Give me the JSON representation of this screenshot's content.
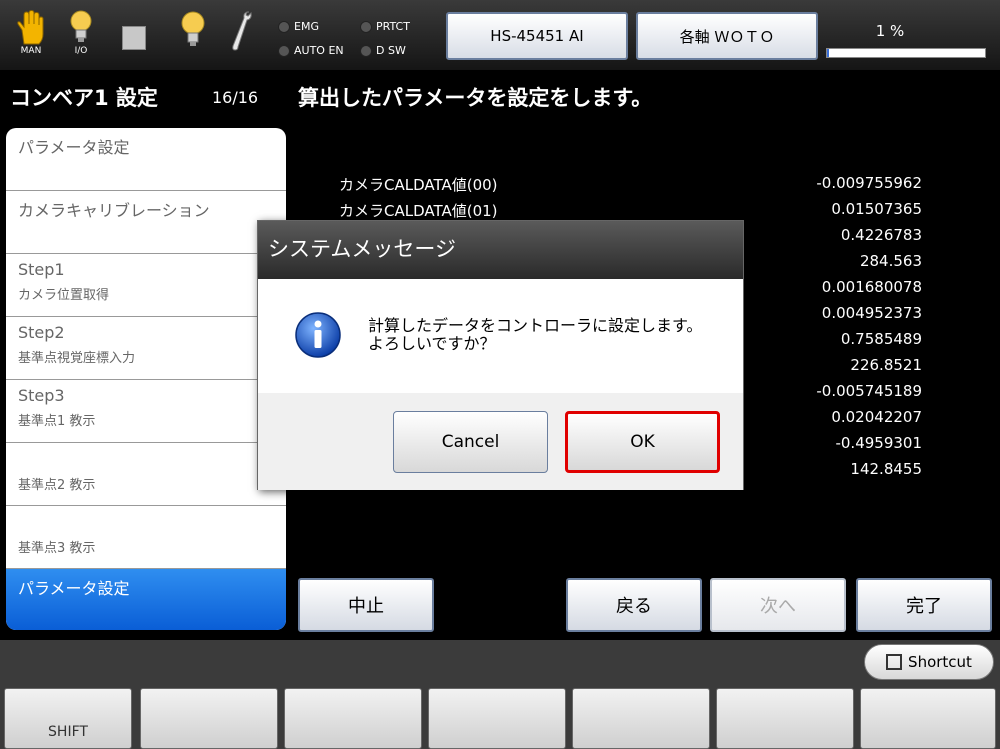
{
  "topbar": {
    "man_label": "MAN",
    "io_label": "I/O",
    "lamps": [
      {
        "label": "EMG"
      },
      {
        "label": "PRTCT"
      },
      {
        "label": "AUTO EN"
      },
      {
        "label": "D SW"
      }
    ],
    "robot_button": "HS-45451 AI",
    "axis_button": "各軸 ＷＯＴＯ",
    "speed_percent": "1 %",
    "speed_value": 0.01
  },
  "left_panel": {
    "title": "コンベア1 設定",
    "counter": "16/16",
    "items": [
      {
        "line1": "パラメータ設定",
        "line2": ""
      },
      {
        "line1": "カメラキャリブレーション",
        "line2": ""
      },
      {
        "line1": "Step1",
        "line2": "カメラ位置取得"
      },
      {
        "line1": "Step2",
        "line2": "基準点視覚座標入力"
      },
      {
        "line1": "Step3",
        "line2": "基準点1 教示"
      },
      {
        "line1": "",
        "line2": "基準点2 教示"
      },
      {
        "line1": "",
        "line2": "基準点3 教示"
      },
      {
        "line1": "パラメータ設定",
        "line2": ""
      }
    ]
  },
  "main": {
    "heading": "算出したパラメータを設定をします。",
    "rows": [
      {
        "name": "カメラCALDATA値(00)",
        "value": "-0.009755962"
      },
      {
        "name": "カメラCALDATA値(01)",
        "value": "0.01507365"
      },
      {
        "name": "",
        "value": "0.4226783"
      },
      {
        "name": "",
        "value": "284.563"
      },
      {
        "name": "",
        "value": "0.001680078"
      },
      {
        "name": "",
        "value": "0.004952373"
      },
      {
        "name": "",
        "value": "0.7585489"
      },
      {
        "name": "",
        "value": "226.8521"
      },
      {
        "name": "",
        "value": "-0.005745189"
      },
      {
        "name": "",
        "value": "0.02042207"
      },
      {
        "name": "",
        "value": "-0.4959301"
      },
      {
        "name": "",
        "value": "142.8455"
      }
    ],
    "buttons": {
      "abort": "中止",
      "back": "戻る",
      "next": "次へ",
      "finish": "完了"
    }
  },
  "dialog": {
    "title": "システムメッセージ",
    "message_line1": "計算したデータをコントローラに設定します。",
    "message_line2": "よろしいですか？",
    "cancel": "Cancel",
    "ok": "OK"
  },
  "bottom": {
    "shortcut": "Shortcut",
    "fkeys": [
      "SHIFT",
      "",
      "",
      "",
      "",
      "",
      ""
    ]
  },
  "colors": {
    "active_item": "#1a73e0",
    "ok_highlight": "#e00000",
    "background": "#000000"
  }
}
